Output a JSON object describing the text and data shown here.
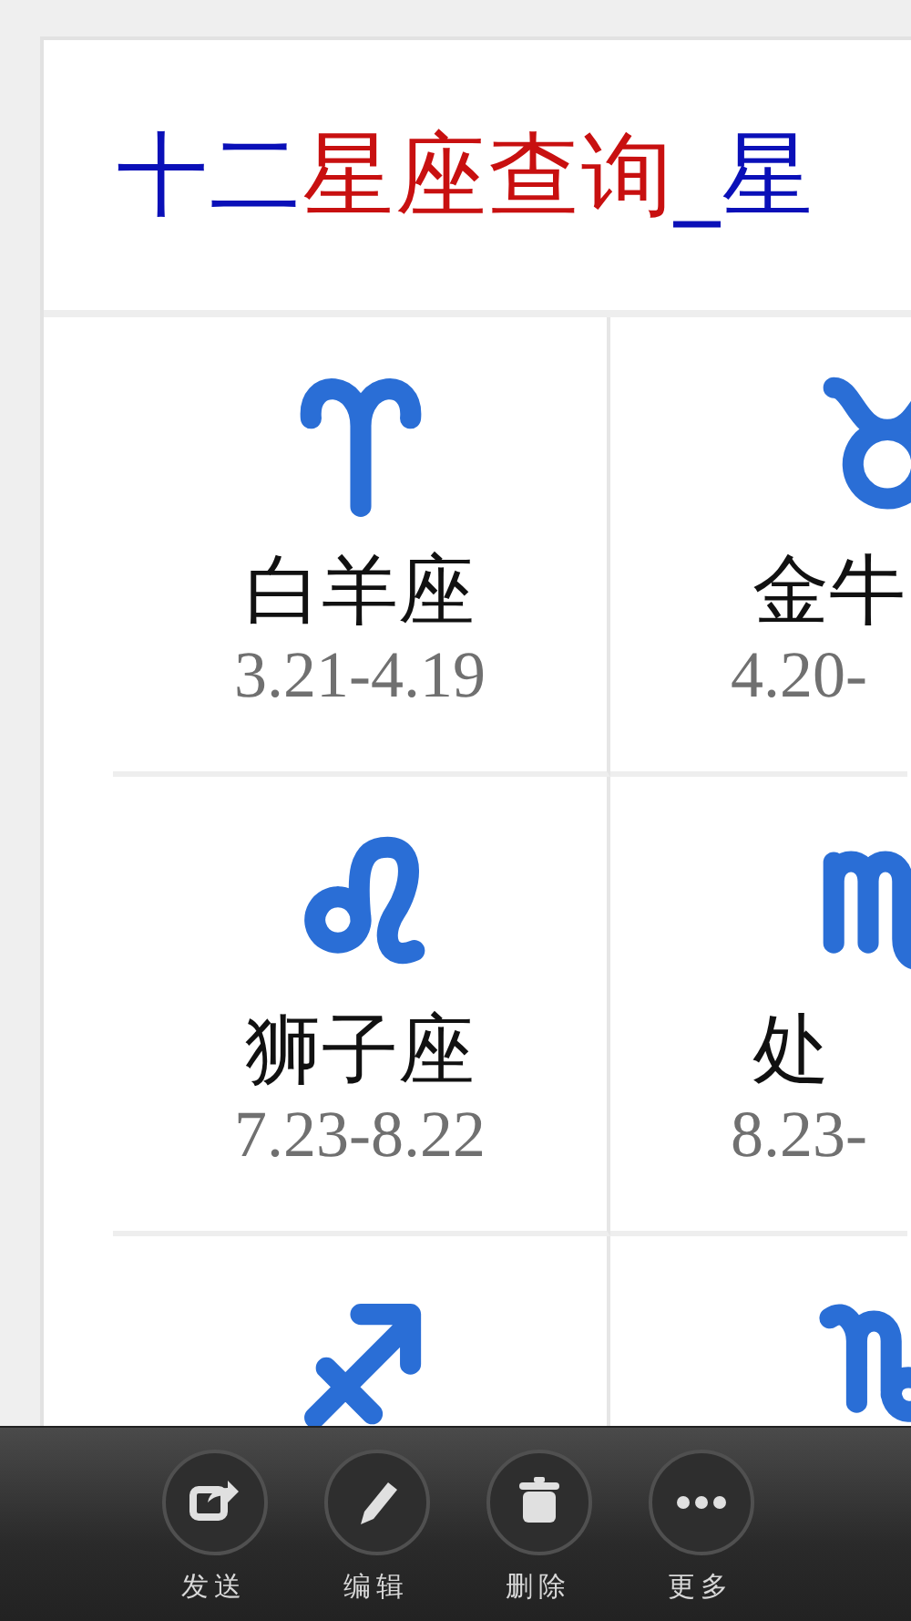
{
  "header": {
    "title": [
      {
        "text": "十二",
        "color": "#0a10b8"
      },
      {
        "text": "星座查询",
        "color": "#c81010"
      },
      {
        "text": "_星",
        "color": "#0a10b8"
      }
    ]
  },
  "signs": [
    {
      "kind": "aries",
      "name": "白羊座",
      "dates": "3.21-4.19"
    },
    {
      "kind": "taurus",
      "name": "金牛",
      "dates": "4.20-"
    },
    {
      "kind": "leo",
      "name": "狮子座",
      "dates": "7.23-8.22"
    },
    {
      "kind": "virgo",
      "name": "处",
      "dates": "8.23-"
    },
    {
      "kind": "sagittarius"
    },
    {
      "kind": "capricorn"
    }
  ],
  "toolbar": [
    {
      "kind": "share",
      "label": "发送"
    },
    {
      "kind": "edit",
      "label": "编辑"
    },
    {
      "kind": "delete",
      "label": "删除"
    },
    {
      "kind": "more",
      "label": "更多"
    }
  ]
}
